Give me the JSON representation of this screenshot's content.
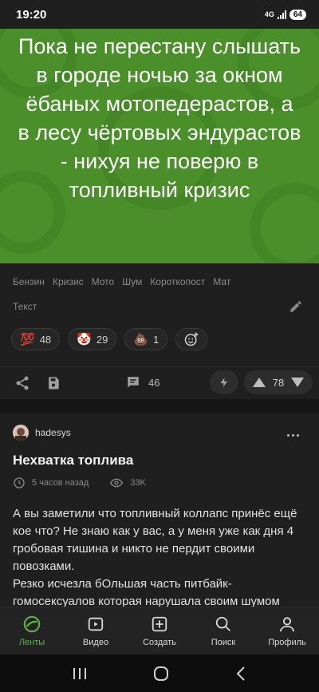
{
  "status": {
    "time": "19:20",
    "network": "4G",
    "battery": "64"
  },
  "post": {
    "headline": "Пока не перестану слышать в городе ночью за окном ёбаных мотопедерастов, а в лесу чёртовых эндурастов - нихуя не поверю в топливный кризис",
    "tags": [
      "Бензин",
      "Кризис",
      "Мото",
      "Шум",
      "Короткопост",
      "Мат"
    ],
    "content_type": "Текст",
    "reactions": [
      {
        "emoji": "💯",
        "count": "48"
      },
      {
        "emoji": "🤡",
        "count": "29"
      },
      {
        "emoji": "💩",
        "count": "1"
      }
    ],
    "comments_count": "46",
    "rating": "78"
  },
  "next_post": {
    "author": "hadesys",
    "title": "Нехватка топлива",
    "time_ago": "5 часов назад",
    "views": "33K",
    "body": "А вы заметили что топливный коллапс принёс ещё кое что? Не знаю как у вас, а у меня уже как дня 4 гробовая тишина и никто не пердит своими повозками.\nРезко исчезла бОльшая часть питбайк-гомосексуалов которая нарушала своим шумом"
  },
  "bottom_nav": [
    {
      "label": "Ленты",
      "icon": "feed-icon",
      "active": true
    },
    {
      "label": "Видео",
      "icon": "video-icon",
      "active": false
    },
    {
      "label": "Создать",
      "icon": "create-icon",
      "active": false
    },
    {
      "label": "Поиск",
      "icon": "search-icon",
      "active": false
    },
    {
      "label": "Профиль",
      "icon": "profile-icon",
      "active": false
    }
  ],
  "colors": {
    "accent": "#5fb14a",
    "hero_bg": "#4a8f2a",
    "background": "#1f1f1f"
  }
}
